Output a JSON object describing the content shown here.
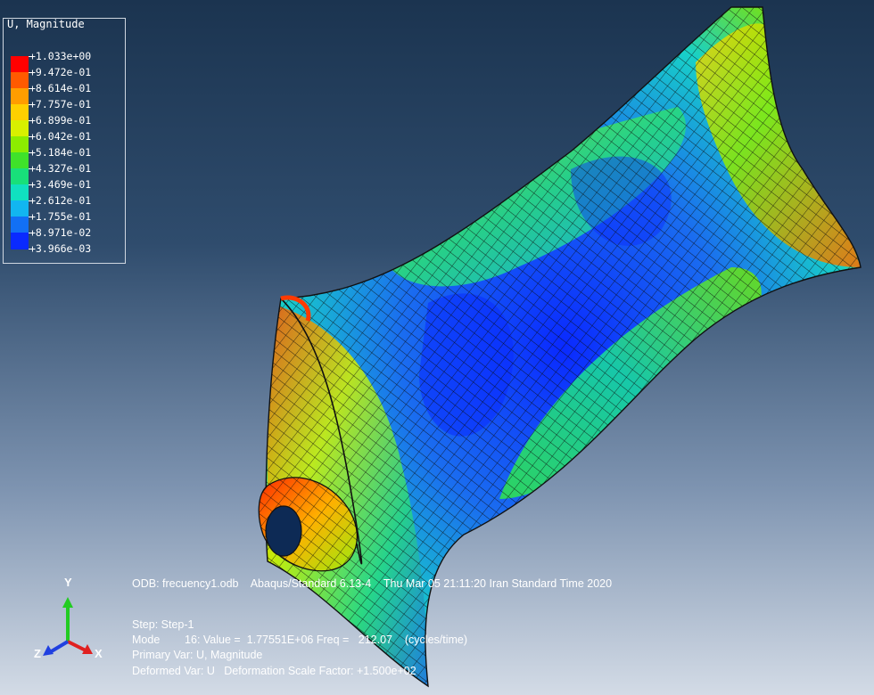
{
  "legend": {
    "title": "U, Magnitude",
    "labels": [
      "+1.033e+00",
      "+9.472e-01",
      "+8.614e-01",
      "+7.757e-01",
      "+6.899e-01",
      "+6.042e-01",
      "+5.184e-01",
      "+4.327e-01",
      "+3.469e-01",
      "+2.612e-01",
      "+1.755e-01",
      "+8.971e-02",
      "+3.966e-03"
    ],
    "colors": [
      "#ff0000",
      "#ff5a00",
      "#ff9d00",
      "#ffd000",
      "#d8f000",
      "#8cec00",
      "#3fe22a",
      "#18e07a",
      "#10e0c0",
      "#12b6f0",
      "#1270f5",
      "#0a2aff"
    ]
  },
  "info": {
    "odb_line": "ODB: frecuency1.odb    Abaqus/Standard 6.13-4    Thu Mar 05 21:11:20 Iran Standard Time 2020",
    "step_line": "Step: Step-1",
    "mode_line": "Mode        16: Value =  1.77551E+06 Freq =   212.07    (cycles/time)",
    "primary_line": "Primary Var: U, Magnitude",
    "deformed_line": "Deformed Var: U   Deformation Scale Factor: +1.500e+02"
  },
  "triad": {
    "y_label": "Y",
    "z_label": "Z",
    "x_label": "X"
  }
}
